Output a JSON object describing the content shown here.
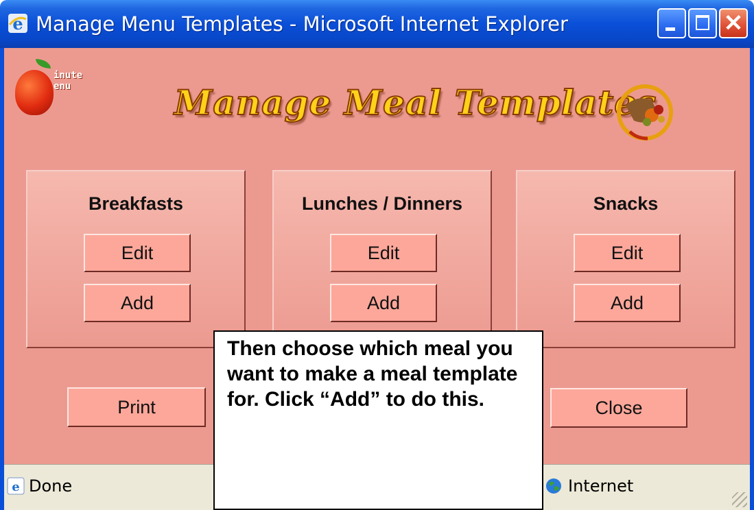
{
  "window": {
    "title": "Manage Menu Templates - Microsoft Internet Explorer",
    "icon": "ie-icon",
    "controls": [
      "minimize",
      "maximize",
      "close"
    ]
  },
  "header": {
    "logo_text_line1": "inute",
    "logo_text_line2": "enu",
    "heading": "Manage Meal Templates",
    "decoration": "cornucopia-icon"
  },
  "panels": [
    {
      "title": "Breakfasts",
      "edit_label": "Edit",
      "add_label": "Add"
    },
    {
      "title": "Lunches / Dinners",
      "edit_label": "Edit",
      "add_label": "Add"
    },
    {
      "title": "Snacks",
      "edit_label": "Edit",
      "add_label": "Add"
    }
  ],
  "footer_buttons": {
    "print_label": "Print",
    "close_label": "Close"
  },
  "callout": {
    "text": "Then choose which meal you want to make a meal template for. Click “Add” to do this."
  },
  "statusbar": {
    "status": "Done",
    "zone": "Internet"
  },
  "colors": {
    "background": "#ec9a90",
    "button": "#fca79a",
    "titlebar": "#0a4fd8",
    "heading": "#ffd21a"
  }
}
